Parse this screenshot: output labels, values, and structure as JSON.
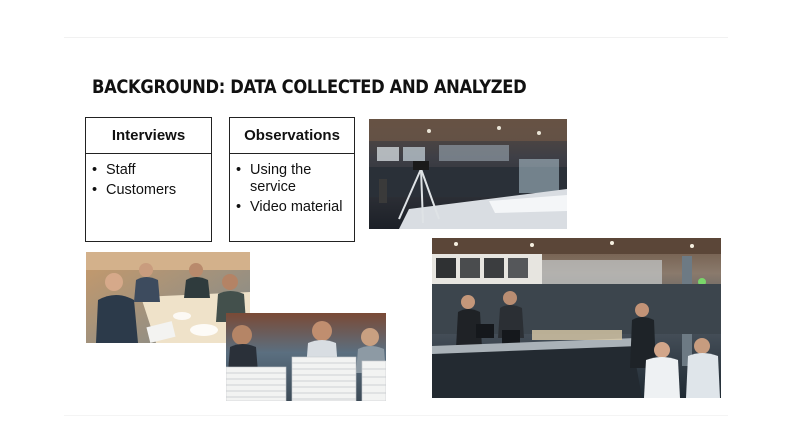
{
  "slide": {
    "title": "BACKGROUND: DATA COLLECTED AND ANALYZED"
  },
  "boxes": [
    {
      "header": "Interviews",
      "items": [
        "Staff",
        "Customers"
      ]
    },
    {
      "header": "Observations",
      "items": [
        "Using the service",
        "Video material"
      ]
    }
  ],
  "photos": [
    {
      "name": "camera-tripod-in-cafeteria-photo"
    },
    {
      "name": "meeting-around-table-photo"
    },
    {
      "name": "people-behind-plate-stacks-photo"
    },
    {
      "name": "cafeteria-service-counter-photo"
    }
  ]
}
